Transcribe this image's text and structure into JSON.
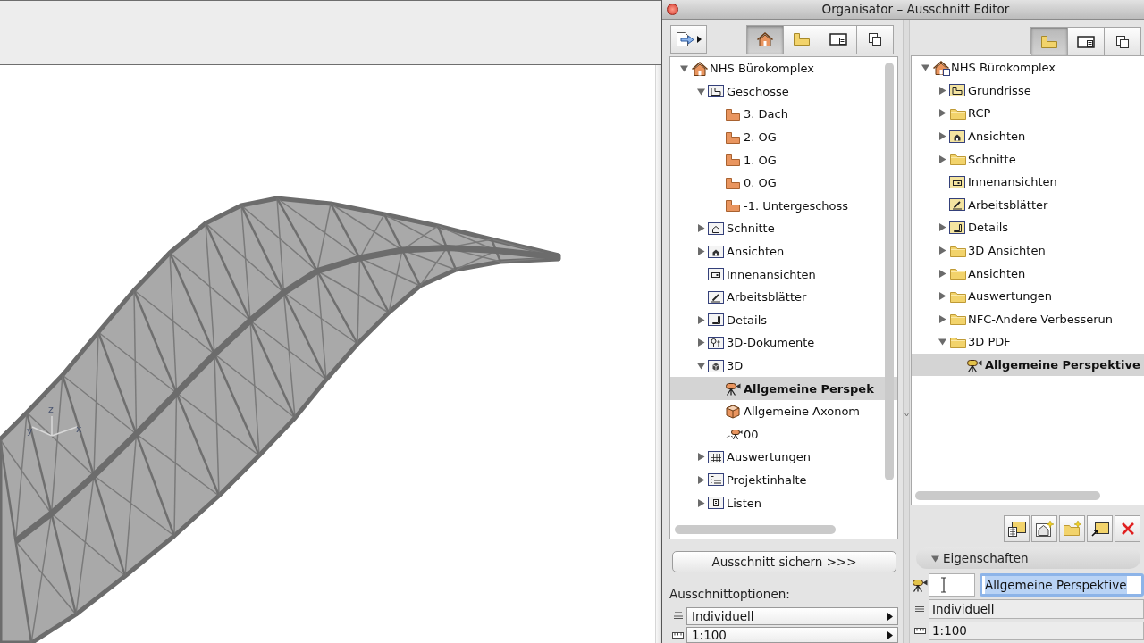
{
  "viewport": {
    "axis_labels": [
      "y",
      "z",
      "x"
    ]
  },
  "window": {
    "title": "Organisator – Ausschnitt Editor"
  },
  "left_pane": {
    "tabs": [
      {
        "selected": true
      },
      {
        "selected": false
      },
      {
        "selected": false
      },
      {
        "selected": false
      }
    ],
    "tree": [
      {
        "label": "NHS Bürokomplex",
        "kind": "project",
        "expanded": true,
        "selected": false,
        "children": [
          {
            "label": "Geschosse",
            "kind": "floors",
            "expanded": true,
            "selected": false,
            "children": [
              {
                "label": "3. Dach",
                "kind": "floor",
                "selected": false
              },
              {
                "label": "2. OG",
                "kind": "floor",
                "selected": false
              },
              {
                "label": "1. OG",
                "kind": "floor",
                "selected": false
              },
              {
                "label": "0. OG",
                "kind": "floor",
                "selected": false
              },
              {
                "label": "-1. Untergeschoss",
                "kind": "floor",
                "selected": false
              }
            ]
          },
          {
            "label": "Schnitte",
            "kind": "section",
            "expanded": false,
            "selected": false
          },
          {
            "label": "Ansichten",
            "kind": "elevation",
            "expanded": false,
            "selected": false
          },
          {
            "label": "Innenansichten",
            "kind": "interior",
            "selected": false
          },
          {
            "label": "Arbeitsblätter",
            "kind": "worksheet",
            "selected": false
          },
          {
            "label": "Details",
            "kind": "detail",
            "expanded": false,
            "selected": false
          },
          {
            "label": "3D-Dokumente",
            "kind": "document3d",
            "expanded": false,
            "selected": false
          },
          {
            "label": "3D",
            "kind": "view3d",
            "expanded": true,
            "selected": false,
            "children": [
              {
                "label": "Allgemeine Perspek",
                "kind": "camera",
                "selected": true
              },
              {
                "label": "Allgemeine Axonom",
                "kind": "axon",
                "selected": false
              },
              {
                "label": "00",
                "kind": "camera-path",
                "selected": false
              }
            ]
          },
          {
            "label": "Auswertungen",
            "kind": "schedule",
            "expanded": false,
            "selected": false
          },
          {
            "label": "Projektinhalte",
            "kind": "contents",
            "expanded": false,
            "selected": false
          },
          {
            "label": "Listen",
            "kind": "list",
            "expanded": false,
            "selected": false
          }
        ]
      }
    ],
    "save_button": "Ausschnitt sichern >>>",
    "options_label": "Ausschnittoptionen:",
    "options": [
      "Individuell",
      "1:100"
    ]
  },
  "right_pane": {
    "tabs": [
      {
        "selected": true
      },
      {
        "selected": false
      },
      {
        "selected": false
      }
    ],
    "tree": [
      {
        "label": "NHS Bürokomplex",
        "kind": "project-set",
        "expanded": true,
        "selected": false,
        "children": [
          {
            "label": "Grundrisse",
            "kind": "floors",
            "expanded": false,
            "selected": false
          },
          {
            "label": "RCP",
            "kind": "folder",
            "expanded": false,
            "selected": false
          },
          {
            "label": "Ansichten",
            "kind": "elevation",
            "expanded": false,
            "selected": false
          },
          {
            "label": "Schnitte",
            "kind": "folder",
            "expanded": false,
            "selected": false
          },
          {
            "label": "Innenansichten",
            "kind": "interior",
            "selected": false
          },
          {
            "label": "Arbeitsblätter",
            "kind": "worksheet",
            "selected": false
          },
          {
            "label": "Details",
            "kind": "detail",
            "expanded": false,
            "selected": false
          },
          {
            "label": "3D Ansichten",
            "kind": "folder",
            "expanded": false,
            "selected": false
          },
          {
            "label": "Ansichten",
            "kind": "folder",
            "expanded": false,
            "selected": false
          },
          {
            "label": "Auswertungen",
            "kind": "folder",
            "expanded": false,
            "selected": false
          },
          {
            "label": "NFC-Andere Verbesserun",
            "kind": "folder",
            "expanded": false,
            "selected": false
          },
          {
            "label": "3D PDF",
            "kind": "folder",
            "expanded": true,
            "selected": false,
            "children": [
              {
                "label": "Allgemeine Perspektive",
                "kind": "camera",
                "selected": true
              }
            ]
          }
        ]
      }
    ],
    "properties": {
      "title": "Eigenschaften",
      "expanded": true,
      "name_field": {
        "value": "Allgemeine Perspektive",
        "focused": true
      },
      "rows": [
        "Individuell",
        "1:100"
      ]
    }
  }
}
